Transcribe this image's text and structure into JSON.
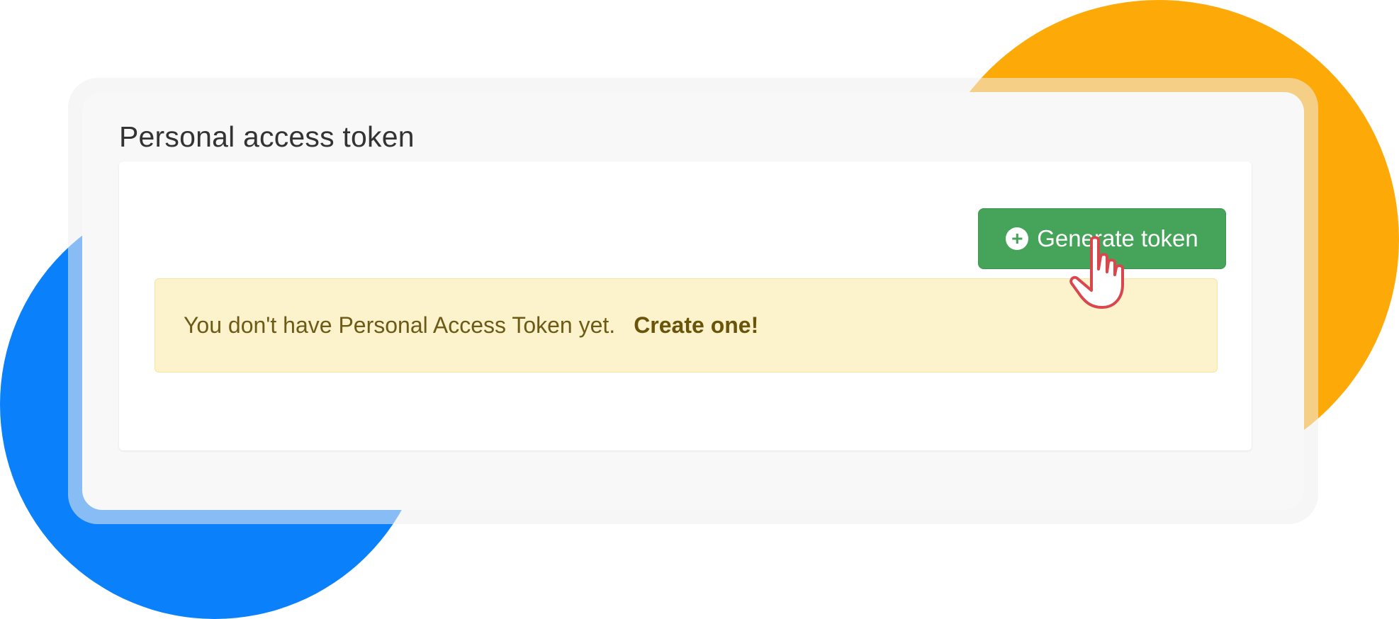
{
  "page": {
    "title": "Personal access token"
  },
  "toolbar": {
    "generate_label": "Generate token",
    "generate_icon": "plus-circle-icon"
  },
  "alert": {
    "message": "You don't have Personal Access Token yet.",
    "link_label": "Create one!"
  },
  "cursor": {
    "icon": "hand-pointer-icon"
  },
  "colors": {
    "button_green": "#46a35a",
    "alert_background": "#fcf3cc",
    "alert_text": "#6d5a16",
    "blob_blue": "#0a80fb",
    "blob_orange": "#fda908",
    "cursor_outline": "#d9474d"
  }
}
